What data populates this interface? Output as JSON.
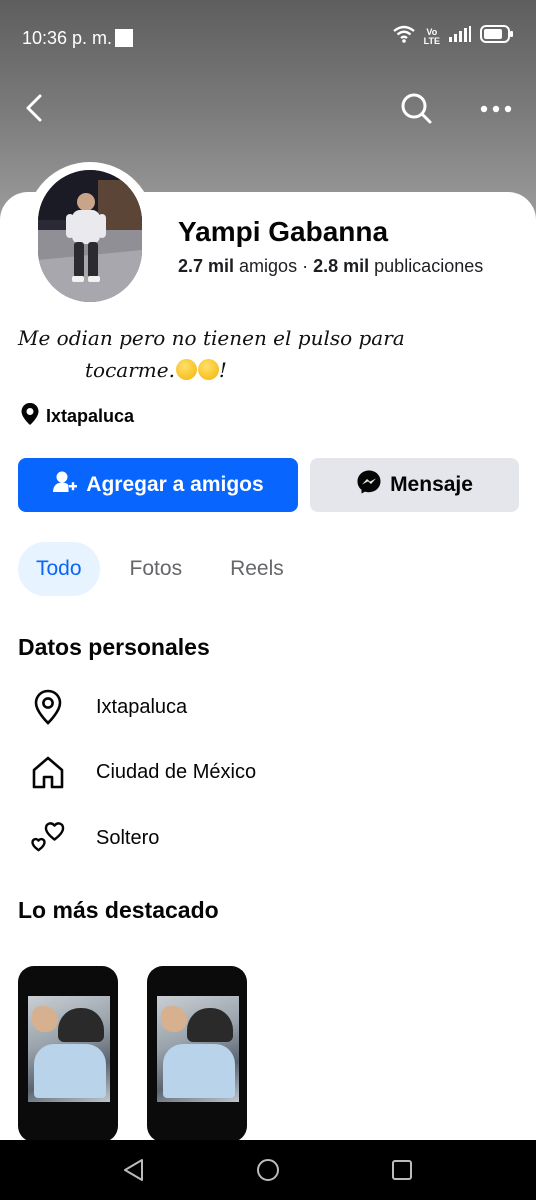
{
  "status_bar": {
    "time": "10:36 p. m.",
    "network_badge_top": "Vo",
    "network_badge_bottom": "LTE",
    "icons": [
      "wifi-icon",
      "volte-icon",
      "signal-icon",
      "battery-icon"
    ]
  },
  "top_nav": {
    "icons": [
      "back-icon",
      "search-icon",
      "more-icon"
    ]
  },
  "profile": {
    "name": "Yampi Gabanna",
    "friends_count": "2.7 mil",
    "friends_label": "amigos",
    "separator": "·",
    "posts_count": "2.8 mil",
    "posts_label": "publicaciones",
    "bio_line1": "Me odian pero no tienen el pulso para",
    "bio_line2": "tocarme.",
    "bio_end": "!",
    "location": "Ixtapaluca"
  },
  "actions": {
    "add_friend": "Agregar a amigos",
    "message": "Mensaje"
  },
  "tabs": [
    {
      "label": "Todo",
      "active": true
    },
    {
      "label": "Fotos",
      "active": false
    },
    {
      "label": "Reels",
      "active": false
    }
  ],
  "personal_details": {
    "title": "Datos personales",
    "items": [
      {
        "icon": "location-pin-icon",
        "text": "Ixtapaluca"
      },
      {
        "icon": "home-icon",
        "text": "Ciudad de México"
      },
      {
        "icon": "hearts-icon",
        "text": "Soltero"
      }
    ]
  },
  "highlights": {
    "title": "Lo más destacado",
    "items": [
      {
        "icon": "highlight-thumbnail"
      },
      {
        "icon": "highlight-thumbnail"
      }
    ]
  },
  "nav_bar": {
    "icons": [
      "nav-back-icon",
      "nav-home-icon",
      "nav-recents-icon"
    ]
  },
  "colors": {
    "primary": "#0866ff",
    "tab_active_bg": "#e7f3ff",
    "secondary_button": "#e4e6eb"
  }
}
